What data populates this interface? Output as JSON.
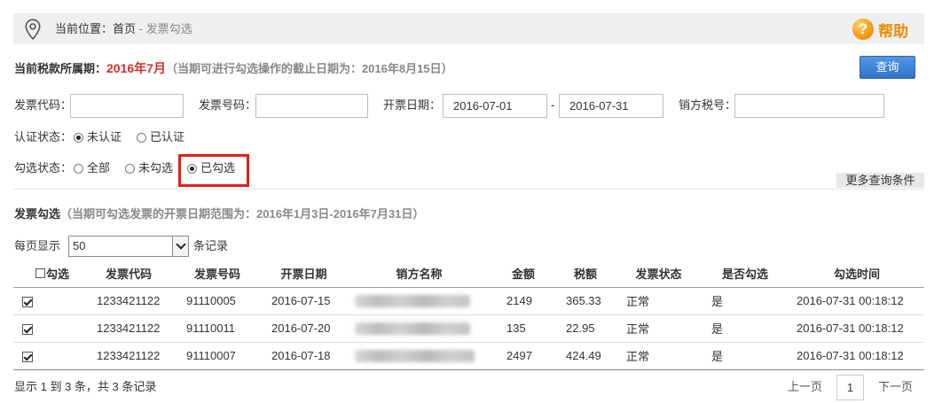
{
  "breadcrumb": {
    "prefix": "当前位置：",
    "home": "首页",
    "separator": "-",
    "current": "发票勾选",
    "icon": "location-pin-icon"
  },
  "help": {
    "label": "帮助",
    "icon": "question-circle-icon",
    "color": "#f08c00"
  },
  "period": {
    "label": "当前税款所属期：",
    "value": "2016年7月",
    "note": "（当期可进行勾选操作的截止日期为：2016年8月15日）",
    "value_color": "#d0302a"
  },
  "query_button": {
    "label": "查询",
    "color": "#3b7fd4"
  },
  "filters": {
    "invoice_code": {
      "label": "发票代码：",
      "value": ""
    },
    "invoice_number": {
      "label": "发票号码：",
      "value": ""
    },
    "invoice_date": {
      "label": "开票日期：",
      "start": "2016-07-01",
      "separator": "-",
      "end": "2016-07-31"
    },
    "seller_tax_id": {
      "label": "销方税号：",
      "value": ""
    }
  },
  "cert_status": {
    "label": "认证状态：",
    "options": [
      {
        "label": "未认证",
        "checked": true
      },
      {
        "label": "已认证",
        "checked": false
      }
    ]
  },
  "select_status": {
    "label": "勾选状态：",
    "options": [
      {
        "label": "全部",
        "checked": false
      },
      {
        "label": "未勾选",
        "checked": false
      },
      {
        "label": "已勾选",
        "checked": true
      }
    ],
    "highlight_color": "#e0201a"
  },
  "more_conditions": {
    "label": "更多查询条件"
  },
  "section": {
    "title": "发票勾选",
    "note": "（当期可勾选发票的开票日期范围为：2016年1月3日-2016年7月31日）"
  },
  "page_size": {
    "label": "每页显示",
    "value": "50",
    "suffix": "条记录"
  },
  "table": {
    "select_all": {
      "label": "勾选",
      "checked": false
    },
    "headers": [
      "发票代码",
      "发票号码",
      "开票日期",
      "销方名称",
      "金额",
      "税额",
      "发票状态",
      "是否勾选",
      "勾选时间"
    ],
    "rows": [
      {
        "checked": true,
        "code": "1233421122",
        "number": "91110005",
        "date": "2016-07-15",
        "amount": "2149",
        "tax": "365.33",
        "status": "正常",
        "selected": "是",
        "time": "2016-07-31 00:18:12"
      },
      {
        "checked": true,
        "code": "1233421122",
        "number": "91110011",
        "date": "2016-07-20",
        "amount": "135",
        "tax": "22.95",
        "status": "正常",
        "selected": "是",
        "time": "2016-07-31 00:18:12"
      },
      {
        "checked": true,
        "code": "1233421122",
        "number": "91110007",
        "date": "2016-07-18",
        "amount": "2497",
        "tax": "424.49",
        "status": "正常",
        "selected": "是",
        "time": "2016-07-31 00:18:12"
      }
    ]
  },
  "footer": {
    "summary": "显示 1 到 3 条，共 3 条记录",
    "prev": "上一页",
    "page": "1",
    "next": "下一页"
  }
}
